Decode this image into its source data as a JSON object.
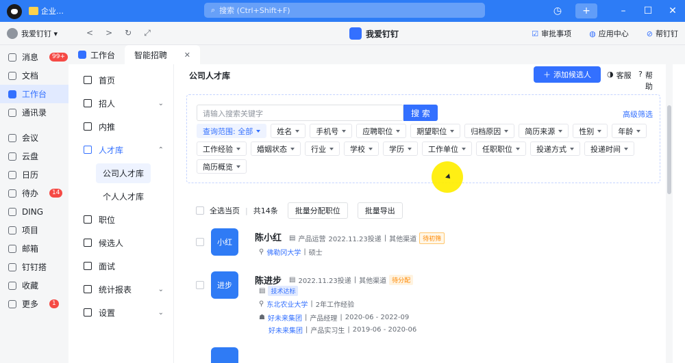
{
  "titlebar": {
    "app_name": "企业…",
    "search_placeholder": "搜索 (Ctrl+Shift+F)",
    "history_icon": "clock",
    "plus": "+",
    "minimize": "–",
    "maximize": "☐",
    "close": "✕"
  },
  "toolbar": {
    "org": "我爱钉钉 ▾",
    "back": "<",
    "forward": ">",
    "refresh": "↻",
    "popout": "⤢",
    "title": "我爱钉钉",
    "links": [
      "审批事项",
      "应用中心",
      "帮钉钉"
    ]
  },
  "sidebar": {
    "items": [
      {
        "label": "消息",
        "badge": "99+"
      },
      {
        "label": "文档",
        "badge": ""
      },
      {
        "label": "工作台",
        "badge": "",
        "active": true
      },
      {
        "label": "通讯录",
        "badge": ""
      },
      {
        "label": "会议",
        "badge": ""
      },
      {
        "label": "云盘",
        "badge": ""
      },
      {
        "label": "日历",
        "badge": ""
      },
      {
        "label": "待办",
        "badge": "14"
      },
      {
        "label": "DING",
        "badge": ""
      },
      {
        "label": "项目",
        "badge": ""
      },
      {
        "label": "邮箱",
        "badge": ""
      },
      {
        "label": "钉钉搭",
        "badge": ""
      },
      {
        "label": "收藏",
        "badge": ""
      },
      {
        "label": "更多",
        "badge": "1"
      }
    ]
  },
  "tabs": [
    {
      "label": "工作台"
    },
    {
      "label": "智能招聘",
      "close": "✕"
    }
  ],
  "nav": {
    "items": [
      {
        "label": "首页",
        "arrow": ""
      },
      {
        "label": "招人",
        "arrow": "⌄"
      },
      {
        "label": "内推",
        "arrow": ""
      },
      {
        "label": "人才库",
        "arrow": "⌃"
      }
    ],
    "sub": [
      "公司人才库",
      "个人人才库"
    ],
    "items2": [
      {
        "label": "职位",
        "arrow": ""
      },
      {
        "label": "候选人",
        "arrow": ""
      },
      {
        "label": "面试",
        "arrow": ""
      },
      {
        "label": "统计报表",
        "arrow": "⌄"
      },
      {
        "label": "设置",
        "arrow": "⌄"
      }
    ]
  },
  "main": {
    "title": "公司人才库",
    "add_button": "添加候选人",
    "service": "客服",
    "help": "帮助",
    "search_placeholder": "请输入搜索关键字",
    "search_button": "搜 索",
    "advanced": "高级筛选",
    "filters": [
      {
        "label": "查询范围: 全部",
        "selected": true
      },
      {
        "label": "姓名"
      },
      {
        "label": "手机号"
      },
      {
        "label": "应聘职位"
      },
      {
        "label": "期望职位"
      },
      {
        "label": "归档原因"
      },
      {
        "label": "简历来源"
      },
      {
        "label": "性别"
      },
      {
        "label": "年龄"
      },
      {
        "label": "工作经验"
      },
      {
        "label": "婚姻状态"
      },
      {
        "label": "行业"
      },
      {
        "label": "学校"
      },
      {
        "label": "学历"
      },
      {
        "label": "工作单位"
      },
      {
        "label": "任职职位"
      },
      {
        "label": "投递方式"
      },
      {
        "label": "投递时间"
      },
      {
        "label": "简历概览"
      }
    ],
    "bulk": {
      "select_all": "全选当页",
      "count": "共14条",
      "assign": "批量分配职位",
      "export": "批量导出"
    },
    "candidates": [
      {
        "avatar": "小红",
        "name": "陈小红",
        "position": "产品运营",
        "date": "2022.11.23投递",
        "source": "其他渠道",
        "status": "待初筛",
        "school": "佛勒冈大学",
        "degree": "硕士"
      },
      {
        "avatar": "进步",
        "name": "陈进步",
        "date": "2022.11.23投递",
        "source": "其他渠道",
        "status": "待分配",
        "skill_tag": "技术达标",
        "school": "东北农业大学",
        "exp": "2年工作经验",
        "jobs": [
          {
            "company": "好未来集团",
            "title": "产品经理",
            "period": "2020-06 - 2022-09"
          },
          {
            "company": "好未来集团",
            "title": "产品实习生",
            "period": "2019-06 - 2020-06"
          }
        ]
      }
    ]
  }
}
